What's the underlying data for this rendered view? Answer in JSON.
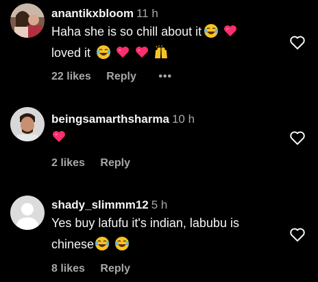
{
  "comments": [
    {
      "username": "anantikxbloom",
      "time": "11 h",
      "text_line1": "Haha she is so chill about it",
      "text_line2": "loved it",
      "likes": "22 likes",
      "reply": "Reply",
      "more": "•••"
    },
    {
      "username": "beingsamarthsharma",
      "time": "10 h",
      "likes": "2 likes",
      "reply": "Reply"
    },
    {
      "username": "shady_slimmm12",
      "time": "5 h",
      "text_line1": "Yes buy lafufu it's indian, labubu is",
      "text_line2": "chinese",
      "likes": "8 likes",
      "reply": "Reply"
    }
  ],
  "icons": {
    "laugh": "face-with-tears-of-joy-icon",
    "heart": "pink-heart-icon",
    "hands": "raising-hands-icon",
    "like": "heart-outline-icon"
  },
  "colors": {
    "background": "#000000",
    "text": "#f5f5f5",
    "muted": "#a8a8a8",
    "heart_emoji": "#ff2d6e"
  }
}
